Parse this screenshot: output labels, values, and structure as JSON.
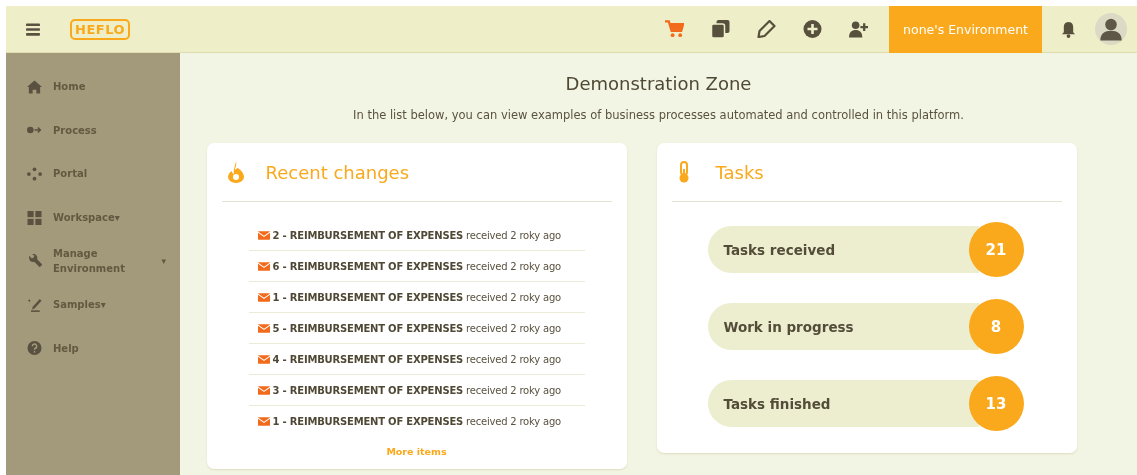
{
  "header": {
    "logo": "HEFLO",
    "tools": [
      {
        "kind": "cart"
      },
      {
        "kind": "copy"
      },
      {
        "kind": "pencil"
      },
      {
        "kind": "plus"
      },
      {
        "kind": "add-user"
      }
    ],
    "environment": "none's Environment"
  },
  "sidebar": {
    "items": [
      {
        "kind": "home",
        "label": "Home"
      },
      {
        "kind": "process",
        "label": "Process"
      },
      {
        "kind": "portal",
        "label": "Portal"
      },
      {
        "kind": "grid",
        "label": "Workspace",
        "caret": "▾"
      },
      {
        "kind": "wrench",
        "label": "Manage Environment",
        "caret": "▾",
        "caret_right": true
      },
      {
        "kind": "samples",
        "label": "Samples",
        "caret": "▾"
      },
      {
        "kind": "help",
        "label": "Help"
      }
    ]
  },
  "main": {
    "title": "Demonstration Zone",
    "subtitle": "In the list below, you can view examples of business processes automated and controlled in this platform."
  },
  "recent": {
    "title": "Recent changes",
    "items": [
      "**2 - REIMBURSEMENT OF EXPENSES** received 2 roky ago",
      "**6 - REIMBURSEMENT OF EXPENSES** received 2 roky ago",
      "**1 - REIMBURSEMENT OF EXPENSES** received 2 roky ago",
      "**5 - REIMBURSEMENT OF EXPENSES** received 2 roky ago",
      "**4 - REIMBURSEMENT OF EXPENSES** received 2 roky ago",
      "**3 - REIMBURSEMENT OF EXPENSES** received 2 roky ago",
      "**1 - REIMBURSEMENT OF EXPENSES** received 2 roky ago"
    ],
    "more": "More items"
  },
  "tasks": {
    "title": "Tasks",
    "items": [
      {
        "label": "Tasks received",
        "count": "21"
      },
      {
        "label": "Work in progress",
        "count": "8"
      },
      {
        "label": "Tasks finished",
        "count": "13"
      }
    ]
  }
}
